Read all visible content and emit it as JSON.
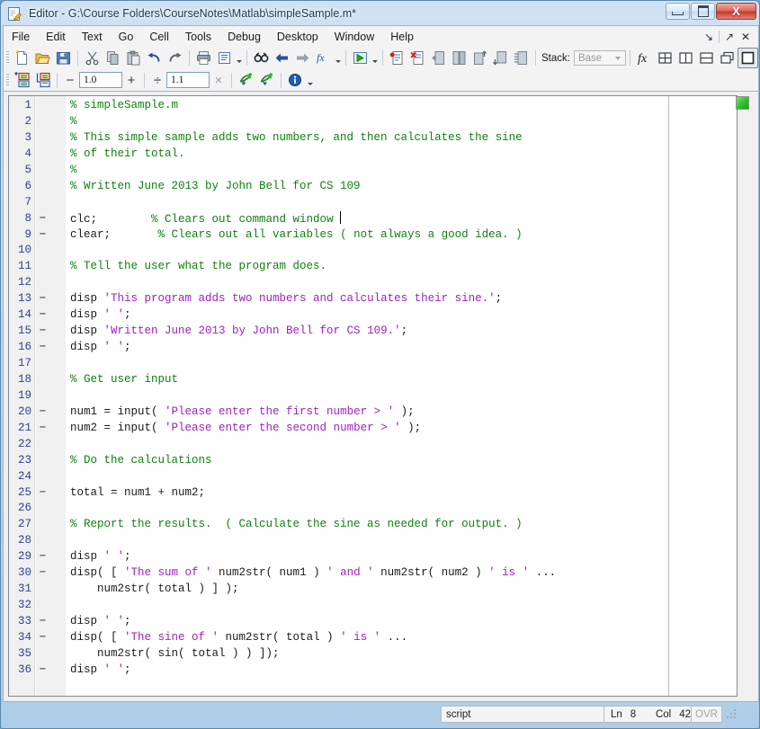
{
  "window": {
    "title": "Editor - G:\\Course Folders\\CourseNotes\\Matlab\\simpleSample.m*",
    "title_icon": "editor-document-pencil-icon",
    "minimize_label": "Minimize",
    "maximize_label": "Maximize",
    "close_label": "X"
  },
  "menubar": {
    "items": [
      {
        "label": "File"
      },
      {
        "label": "Edit"
      },
      {
        "label": "Text"
      },
      {
        "label": "Go"
      },
      {
        "label": "Cell"
      },
      {
        "label": "Tools"
      },
      {
        "label": "Debug"
      },
      {
        "label": "Desktop"
      },
      {
        "label": "Window"
      },
      {
        "label": "Help"
      }
    ],
    "dock_icon": "dock-arrow-icon",
    "undock_icon": "undock-arrow-icon",
    "close_icon": "close-x-icon"
  },
  "toolbar_main": {
    "buttons": [
      {
        "name": "new-file-button",
        "tip": "New"
      },
      {
        "name": "open-file-button",
        "tip": "Open"
      },
      {
        "name": "save-file-button",
        "tip": "Save"
      },
      {
        "name": "cut-button",
        "tip": "Cut"
      },
      {
        "name": "copy-button",
        "tip": "Copy"
      },
      {
        "name": "paste-button",
        "tip": "Paste"
      },
      {
        "name": "undo-button",
        "tip": "Undo"
      },
      {
        "name": "redo-button",
        "tip": "Redo"
      },
      {
        "name": "print-button",
        "tip": "Print"
      },
      {
        "name": "publish-button",
        "tip": "Publish"
      },
      {
        "name": "find-button",
        "tip": "Find"
      },
      {
        "name": "back-button",
        "tip": "Back"
      },
      {
        "name": "forward-button",
        "tip": "Forward"
      },
      {
        "name": "function-browser-button",
        "tip": "Function Browser"
      },
      {
        "name": "run-button",
        "tip": "Run"
      },
      {
        "name": "set-breakpoint-button",
        "tip": "Set/Clear Breakpoint"
      },
      {
        "name": "clear-breakpoints-button",
        "tip": "Clear All Breakpoints"
      },
      {
        "name": "step-button",
        "tip": "Step"
      },
      {
        "name": "step-in-button",
        "tip": "Step In"
      },
      {
        "name": "step-out-button",
        "tip": "Step Out"
      },
      {
        "name": "continue-button",
        "tip": "Continue"
      },
      {
        "name": "exit-debug-button",
        "tip": "Exit Debug Mode"
      }
    ],
    "stack": {
      "label": "Stack:",
      "value": "Base"
    },
    "right_buttons": [
      {
        "name": "fx-button",
        "tip": "Insert Function"
      },
      {
        "name": "tile-grid-button",
        "tip": "Tile"
      },
      {
        "name": "tile-vertical-button",
        "tip": "Tile Vertically"
      },
      {
        "name": "tile-horizontal-button",
        "tip": "Tile Horizontally"
      },
      {
        "name": "float-button",
        "tip": "Float"
      },
      {
        "name": "maximize-pane-button",
        "tip": "Maximize"
      }
    ]
  },
  "toolbar_cell": {
    "insert_cell_label": "Insert Cell",
    "insert_cell_divider_label": "Insert Cell Divider",
    "minus_label": "−",
    "value_1": "1.0",
    "plus_label": "+",
    "divide_label": "÷",
    "value_2": "1.1",
    "times_label": "×",
    "eval_cell_label": "Evaluate Cell",
    "eval_cell_advance_label": "Evaluate Cell and Advance",
    "info_label": "Info"
  },
  "editor": {
    "status_indicator": "green-ok-indicator",
    "cursor_line": 8,
    "cursor_col": 42,
    "lines": [
      {
        "num": "1",
        "bp": "",
        "tokens": [
          {
            "t": "% simpleSample.m",
            "c": "cm"
          }
        ]
      },
      {
        "num": "2",
        "bp": "",
        "tokens": [
          {
            "t": "%",
            "c": "cm"
          }
        ]
      },
      {
        "num": "3",
        "bp": "",
        "tokens": [
          {
            "t": "% This simple sample adds two numbers, and then calculates the sine",
            "c": "cm"
          }
        ]
      },
      {
        "num": "4",
        "bp": "",
        "tokens": [
          {
            "t": "% of their total.",
            "c": "cm"
          }
        ]
      },
      {
        "num": "5",
        "bp": "",
        "tokens": [
          {
            "t": "%",
            "c": "cm"
          }
        ]
      },
      {
        "num": "6",
        "bp": "",
        "tokens": [
          {
            "t": "% Written June 2013 by John Bell for CS 109",
            "c": "cm"
          }
        ]
      },
      {
        "num": "7",
        "bp": "",
        "tokens": []
      },
      {
        "num": "8",
        "bp": "−",
        "tokens": [
          {
            "t": "clc;",
            "c": "kw"
          },
          {
            "t": "        ",
            "c": "pl"
          },
          {
            "t": "% Clears out command window ",
            "c": "cm"
          }
        ],
        "caret": true
      },
      {
        "num": "9",
        "bp": "−",
        "tokens": [
          {
            "t": "clear;",
            "c": "kw"
          },
          {
            "t": "       ",
            "c": "pl"
          },
          {
            "t": "% Clears out all variables ( not always a good idea. )",
            "c": "cm"
          }
        ]
      },
      {
        "num": "10",
        "bp": "",
        "tokens": []
      },
      {
        "num": "11",
        "bp": "",
        "tokens": [
          {
            "t": "% Tell the user what the program does.",
            "c": "cm"
          }
        ]
      },
      {
        "num": "12",
        "bp": "",
        "tokens": []
      },
      {
        "num": "13",
        "bp": "−",
        "tokens": [
          {
            "t": "disp ",
            "c": "kw"
          },
          {
            "t": "'This program adds two numbers and calculates their sine.'",
            "c": "st"
          },
          {
            "t": ";",
            "c": "kw"
          }
        ]
      },
      {
        "num": "14",
        "bp": "−",
        "tokens": [
          {
            "t": "disp ",
            "c": "kw"
          },
          {
            "t": "' '",
            "c": "st"
          },
          {
            "t": ";",
            "c": "kw"
          }
        ]
      },
      {
        "num": "15",
        "bp": "−",
        "tokens": [
          {
            "t": "disp ",
            "c": "kw"
          },
          {
            "t": "'Written June 2013 by John Bell for CS 109.'",
            "c": "st"
          },
          {
            "t": ";",
            "c": "kw"
          }
        ]
      },
      {
        "num": "16",
        "bp": "−",
        "tokens": [
          {
            "t": "disp ",
            "c": "kw"
          },
          {
            "t": "' '",
            "c": "st"
          },
          {
            "t": ";",
            "c": "kw"
          }
        ]
      },
      {
        "num": "17",
        "bp": "",
        "tokens": []
      },
      {
        "num": "18",
        "bp": "",
        "tokens": [
          {
            "t": "% Get user input",
            "c": "cm"
          }
        ]
      },
      {
        "num": "19",
        "bp": "",
        "tokens": []
      },
      {
        "num": "20",
        "bp": "−",
        "tokens": [
          {
            "t": "num1 = input( ",
            "c": "kw"
          },
          {
            "t": "'Please enter the first number > '",
            "c": "st"
          },
          {
            "t": " );",
            "c": "kw"
          }
        ]
      },
      {
        "num": "21",
        "bp": "−",
        "tokens": [
          {
            "t": "num2 = input( ",
            "c": "kw"
          },
          {
            "t": "'Please enter the second number > '",
            "c": "st"
          },
          {
            "t": " );",
            "c": "kw"
          }
        ]
      },
      {
        "num": "22",
        "bp": "",
        "tokens": []
      },
      {
        "num": "23",
        "bp": "",
        "tokens": [
          {
            "t": "% Do the calculations",
            "c": "cm"
          }
        ]
      },
      {
        "num": "24",
        "bp": "",
        "tokens": []
      },
      {
        "num": "25",
        "bp": "−",
        "tokens": [
          {
            "t": "total = num1 + num2;",
            "c": "kw"
          }
        ]
      },
      {
        "num": "26",
        "bp": "",
        "tokens": []
      },
      {
        "num": "27",
        "bp": "",
        "tokens": [
          {
            "t": "% Report the results.  ( Calculate the sine as needed for output. )",
            "c": "cm"
          }
        ]
      },
      {
        "num": "28",
        "bp": "",
        "tokens": []
      },
      {
        "num": "29",
        "bp": "−",
        "tokens": [
          {
            "t": "disp ",
            "c": "kw"
          },
          {
            "t": "' '",
            "c": "st"
          },
          {
            "t": ";",
            "c": "kw"
          }
        ]
      },
      {
        "num": "30",
        "bp": "−",
        "tokens": [
          {
            "t": "disp( [ ",
            "c": "kw"
          },
          {
            "t": "'The sum of '",
            "c": "st"
          },
          {
            "t": " num2str( num1 ) ",
            "c": "kw"
          },
          {
            "t": "' and '",
            "c": "st"
          },
          {
            "t": " num2str( num2 ) ",
            "c": "kw"
          },
          {
            "t": "' is '",
            "c": "st"
          },
          {
            "t": " ...",
            "c": "kw"
          }
        ]
      },
      {
        "num": "31",
        "bp": "",
        "tokens": [
          {
            "t": "    num2str( total ) ] );",
            "c": "kw"
          }
        ]
      },
      {
        "num": "32",
        "bp": "",
        "tokens": []
      },
      {
        "num": "33",
        "bp": "−",
        "tokens": [
          {
            "t": "disp ",
            "c": "kw"
          },
          {
            "t": "' '",
            "c": "st"
          },
          {
            "t": ";",
            "c": "kw"
          }
        ]
      },
      {
        "num": "34",
        "bp": "−",
        "tokens": [
          {
            "t": "disp( [ ",
            "c": "kw"
          },
          {
            "t": "'The sine of '",
            "c": "st"
          },
          {
            "t": " num2str( total ) ",
            "c": "kw"
          },
          {
            "t": "' is '",
            "c": "st"
          },
          {
            "t": " ...",
            "c": "kw"
          }
        ]
      },
      {
        "num": "35",
        "bp": "",
        "tokens": [
          {
            "t": "    num2str( sin( total ) ) ]);",
            "c": "kw"
          }
        ]
      },
      {
        "num": "36",
        "bp": "−",
        "tokens": [
          {
            "t": "disp ",
            "c": "kw"
          },
          {
            "t": "' '",
            "c": "st"
          },
          {
            "t": ";",
            "c": "kw"
          }
        ]
      }
    ]
  },
  "statusbar": {
    "file_type": "script",
    "line_label": "Ln",
    "line_value": "8",
    "col_label": "Col",
    "col_value": "42",
    "overwrite_label": "OVR"
  },
  "colors": {
    "comment": "#108010",
    "string": "#a020c0",
    "keyword": "#1a1a1a",
    "line_number": "#2e3f8f",
    "indicator_green": "#31c431",
    "title_bar": "#cfe2f3"
  }
}
